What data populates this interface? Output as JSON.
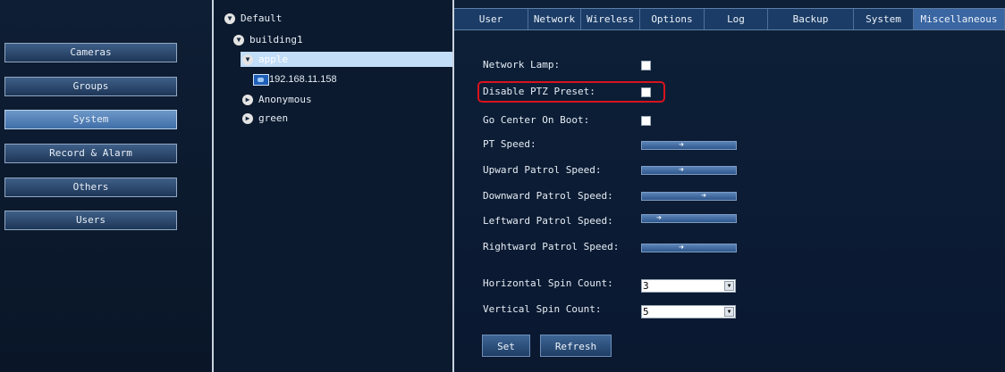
{
  "nav": {
    "items": [
      {
        "label": "Cameras"
      },
      {
        "label": "Groups"
      },
      {
        "label": "System"
      },
      {
        "label": "Record & Alarm"
      },
      {
        "label": "Others"
      },
      {
        "label": "Users"
      }
    ],
    "active": "System"
  },
  "tree": {
    "root": "Default",
    "building": "building1",
    "selected": "apple",
    "camera_ip": "192.168.11.158",
    "anonymous": "Anonymous",
    "green": "green"
  },
  "tabs": {
    "items": [
      {
        "label": "User"
      },
      {
        "label": "Network"
      },
      {
        "label": "Wireless"
      },
      {
        "label": "Options"
      },
      {
        "label": "Log"
      },
      {
        "label": "Backup"
      },
      {
        "label": "System"
      },
      {
        "label": "Miscellaneous"
      }
    ],
    "active": "Miscellaneous"
  },
  "form": {
    "network_lamp": {
      "label": "Network Lamp:",
      "checked": false
    },
    "disable_ptz_preset": {
      "label": "Disable PTZ Preset:",
      "checked": false
    },
    "go_center_on_boot": {
      "label": "Go Center On Boot:",
      "checked": false
    },
    "pt_speed": {
      "label": "PT Speed:",
      "level": 0.4
    },
    "upward_patrol_speed": {
      "label": "Upward Patrol Speed:",
      "level": 0.4
    },
    "downward_patrol_speed": {
      "label": "Downward Patrol Speed:",
      "level": 0.7
    },
    "leftward_patrol_speed": {
      "label": "Leftward Patrol Speed:",
      "level": 0.1
    },
    "rightward_patrol_speed": {
      "label": "Rightward Patrol Speed:",
      "level": 0.4
    },
    "horizontal_spin_count": {
      "label": "Horizontal Spin Count:",
      "value": "3"
    },
    "vertical_spin_count": {
      "label": "Vertical Spin Count:",
      "value": "5"
    }
  },
  "buttons": {
    "set": "Set",
    "refresh": "Refresh"
  },
  "colors": {
    "highlight": "#d9121d",
    "active_nav": "#4f7db3",
    "selected_tree_row": "#c2ddf8"
  }
}
